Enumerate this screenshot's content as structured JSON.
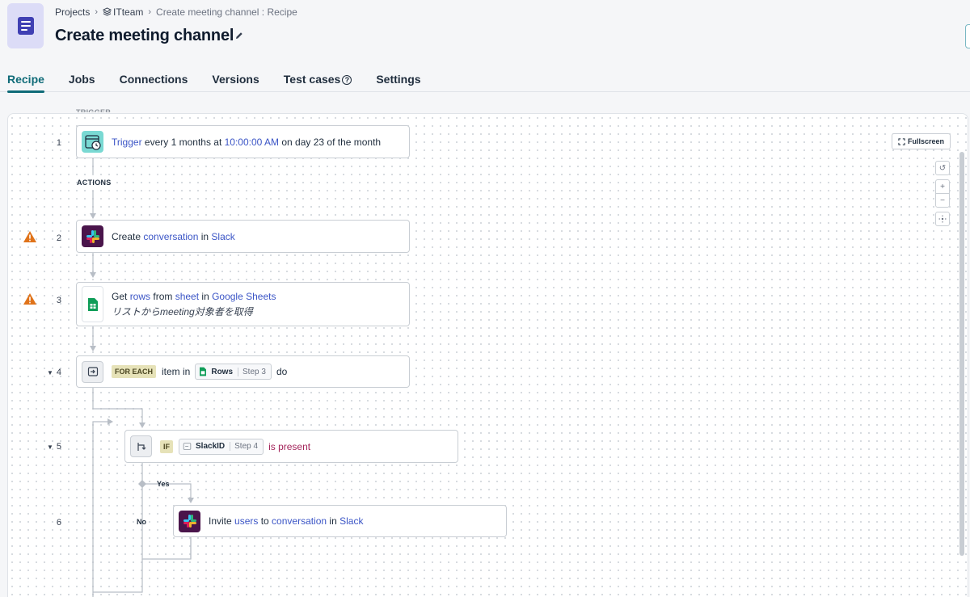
{
  "breadcrumb": {
    "projects": "Projects",
    "team": "ITteam",
    "current": "Create meeting channel : Recipe"
  },
  "title": "Create meeting channel",
  "tabs": [
    {
      "label": "Recipe",
      "active": true
    },
    {
      "label": "Jobs"
    },
    {
      "label": "Connections"
    },
    {
      "label": "Versions"
    },
    {
      "label": "Test cases"
    },
    {
      "label": "Settings"
    }
  ],
  "canvas": {
    "trigger_label": "TRIGGER",
    "actions_label": "ACTIONS",
    "fullscreen_label": "Fullscreen",
    "steps": {
      "s1": {
        "num": "1",
        "w1": "Trigger",
        "w2": " every 1 months at ",
        "w3": "10:00:00 AM",
        "w4": " on day 23 of the month"
      },
      "s2": {
        "num": "2",
        "w1": "Create ",
        "w2": "conversation",
        "w3": " in ",
        "w4": "Slack"
      },
      "s3": {
        "num": "3",
        "w1": "Get ",
        "w2": "rows",
        "w3": " from ",
        "w4": "sheet",
        "w5": " in ",
        "w6": "Google Sheets",
        "subtitle": "リストからmeeting対象者を取得"
      },
      "s4": {
        "num": "4",
        "tag": "FOR EACH",
        "w1": "item in",
        "pill_name": "Rows",
        "pill_step": "Step 3",
        "w2": "do"
      },
      "s5": {
        "num": "5",
        "tag": "IF",
        "pill_name": "SlackID",
        "pill_step": "Step 4",
        "w1": "is present"
      },
      "s6": {
        "num": "6",
        "w1": "Invite ",
        "w2": "users",
        "w3": " to ",
        "w4": "conversation",
        "w5": " in ",
        "w6": "Slack"
      }
    },
    "branch_yes": "Yes",
    "branch_no": "No"
  },
  "colors": {
    "accent": "#0f6b78",
    "link": "#3b55c6",
    "warning": "#e0731a",
    "condition": "#a3245a"
  }
}
